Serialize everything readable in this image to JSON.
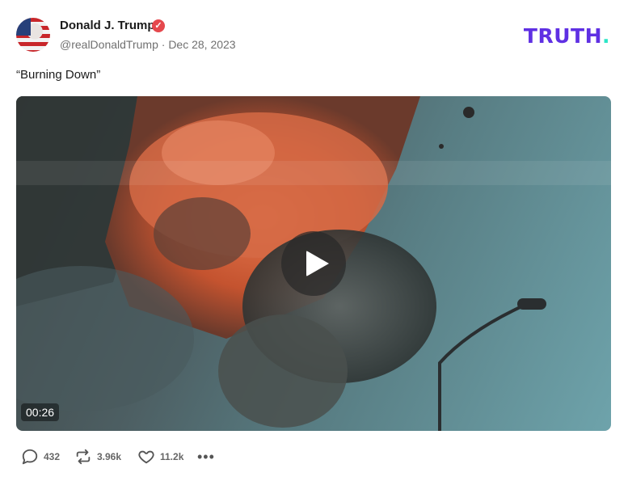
{
  "post": {
    "author_name": "Donald J. Trump",
    "handle": "@realDonaldTrump",
    "separator": "·",
    "date": "Dec 28, 2023",
    "text": "“Burning Down”",
    "video_duration": "00:26"
  },
  "brand": {
    "logo_text": "TRUTH",
    "logo_dot": ".",
    "colors": {
      "logo": "#5f30e3",
      "logo_dot": "#2ce6c7",
      "verified_badge": "#e5484d"
    }
  },
  "actions": {
    "replies": "432",
    "retruths": "3.96k",
    "likes": "11.2k"
  },
  "icons": [
    "verified-badge-icon",
    "reply-icon",
    "retruth-icon",
    "like-icon",
    "more-icon",
    "play-icon"
  ]
}
